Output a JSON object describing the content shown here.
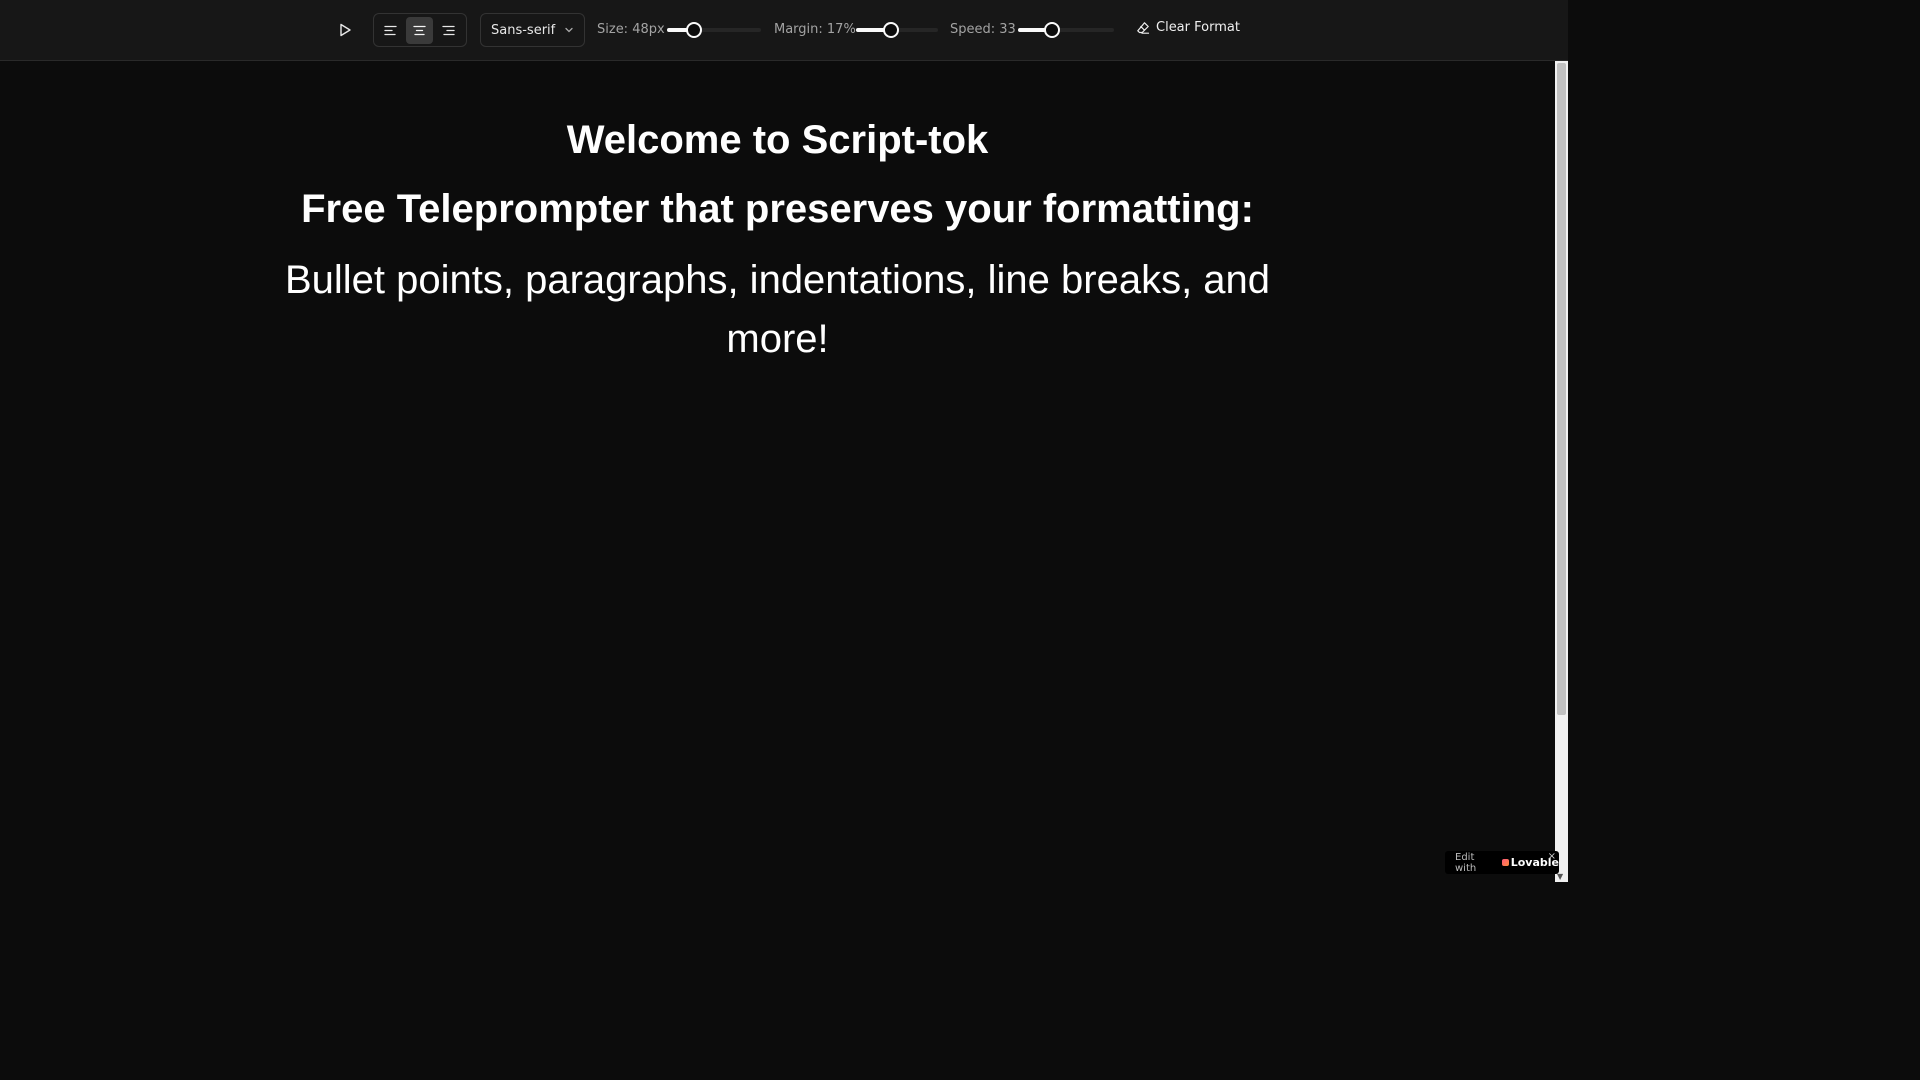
{
  "toolbar": {
    "play_icon": "play-icon",
    "align_left_icon": "align-left-icon",
    "align_center_icon": "align-center-icon",
    "align_right_icon": "align-right-icon",
    "active_alignment": "center",
    "font_value": "Sans-serif",
    "size_label": "Size: 48px",
    "size_value": 48,
    "size_fraction": 0.29,
    "margin_label": "Margin: 17%",
    "margin_value": 17,
    "margin_fraction": 0.43,
    "speed_label": "Speed: 33",
    "speed_value": 33,
    "speed_fraction": 0.35,
    "clear_label": "Clear Format",
    "clear_icon": "eraser-icon"
  },
  "script": {
    "line1": "Welcome to Script-tok",
    "line2": "Free Teleprompter that preserves your formatting:",
    "line3": "Bullet points, paragraphs, indentations, line breaks, and more!"
  },
  "badge": {
    "prefix": "Edit with",
    "brand": "Lovable",
    "close": "×"
  },
  "colors": {
    "background": "#0c0c0c",
    "toolbar": "#171717",
    "text": "#ffffff"
  }
}
